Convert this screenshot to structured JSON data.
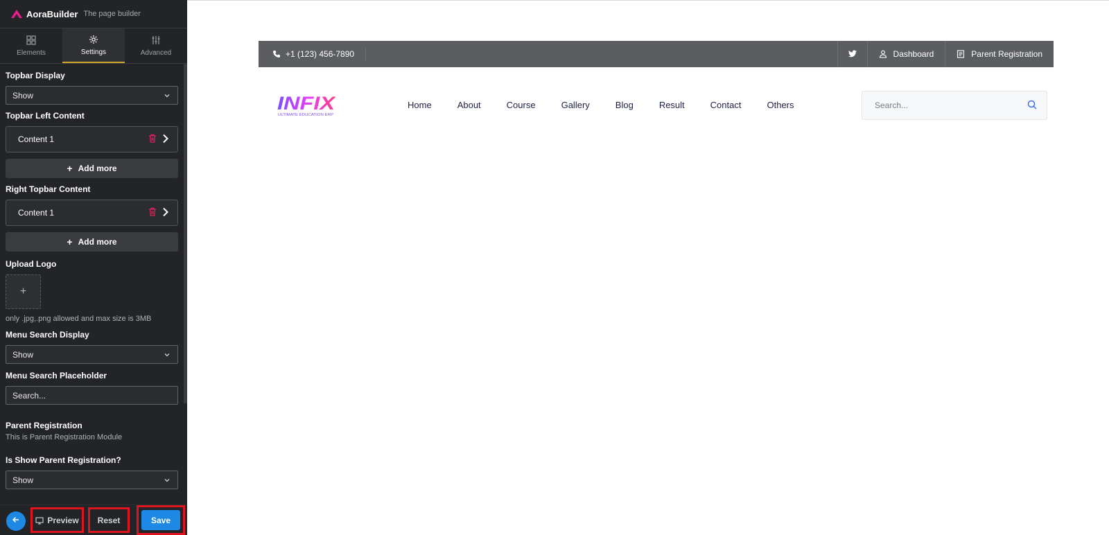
{
  "brand": {
    "name": "AoraBuilder",
    "tagline": "The page builder",
    "accent": "#e91e8c"
  },
  "tabs": [
    {
      "label": "Elements",
      "icon": "grid-icon"
    },
    {
      "label": "Settings",
      "icon": "gear-icon",
      "active": true
    },
    {
      "label": "Advanced",
      "icon": "sliders-icon"
    }
  ],
  "settings": {
    "topbar_display": {
      "label": "Topbar Display",
      "value": "Show"
    },
    "topbar_left": {
      "label": "Topbar Left Content",
      "item": "Content 1",
      "add": "Add more"
    },
    "topbar_right": {
      "label": "Right Topbar Content",
      "item": "Content 1",
      "add": "Add more"
    },
    "upload_logo": {
      "label": "Upload Logo",
      "hint": "only .jpg,.png allowed and max size is 3MB"
    },
    "menu_search_display": {
      "label": "Menu Search Display",
      "value": "Show"
    },
    "menu_search_placeholder": {
      "label": "Menu Search Placeholder",
      "value": "Search..."
    },
    "parent_registration": {
      "title": "Parent Registration",
      "subtitle": "This is Parent Registration Module"
    },
    "is_show_parent_registration": {
      "label": "Is Show Parent Registration?",
      "value": "Show"
    }
  },
  "footer": {
    "preview": "Preview",
    "reset": "Reset",
    "save": "Save",
    "primary_color": "#1e88e5"
  },
  "preview": {
    "topbar": {
      "phone": "+1 (123) 456-7890",
      "dashboard": "Dashboard",
      "parent_registration": "Parent Registration",
      "bg_color": "#5b5d61"
    },
    "logo": {
      "text": "INFIX",
      "sub": "ULTIMATE EDUCATION ERP"
    },
    "menu": [
      "Home",
      "About",
      "Course",
      "Gallery",
      "Blog",
      "Result",
      "Contact",
      "Others"
    ],
    "search_placeholder": "Search..."
  }
}
